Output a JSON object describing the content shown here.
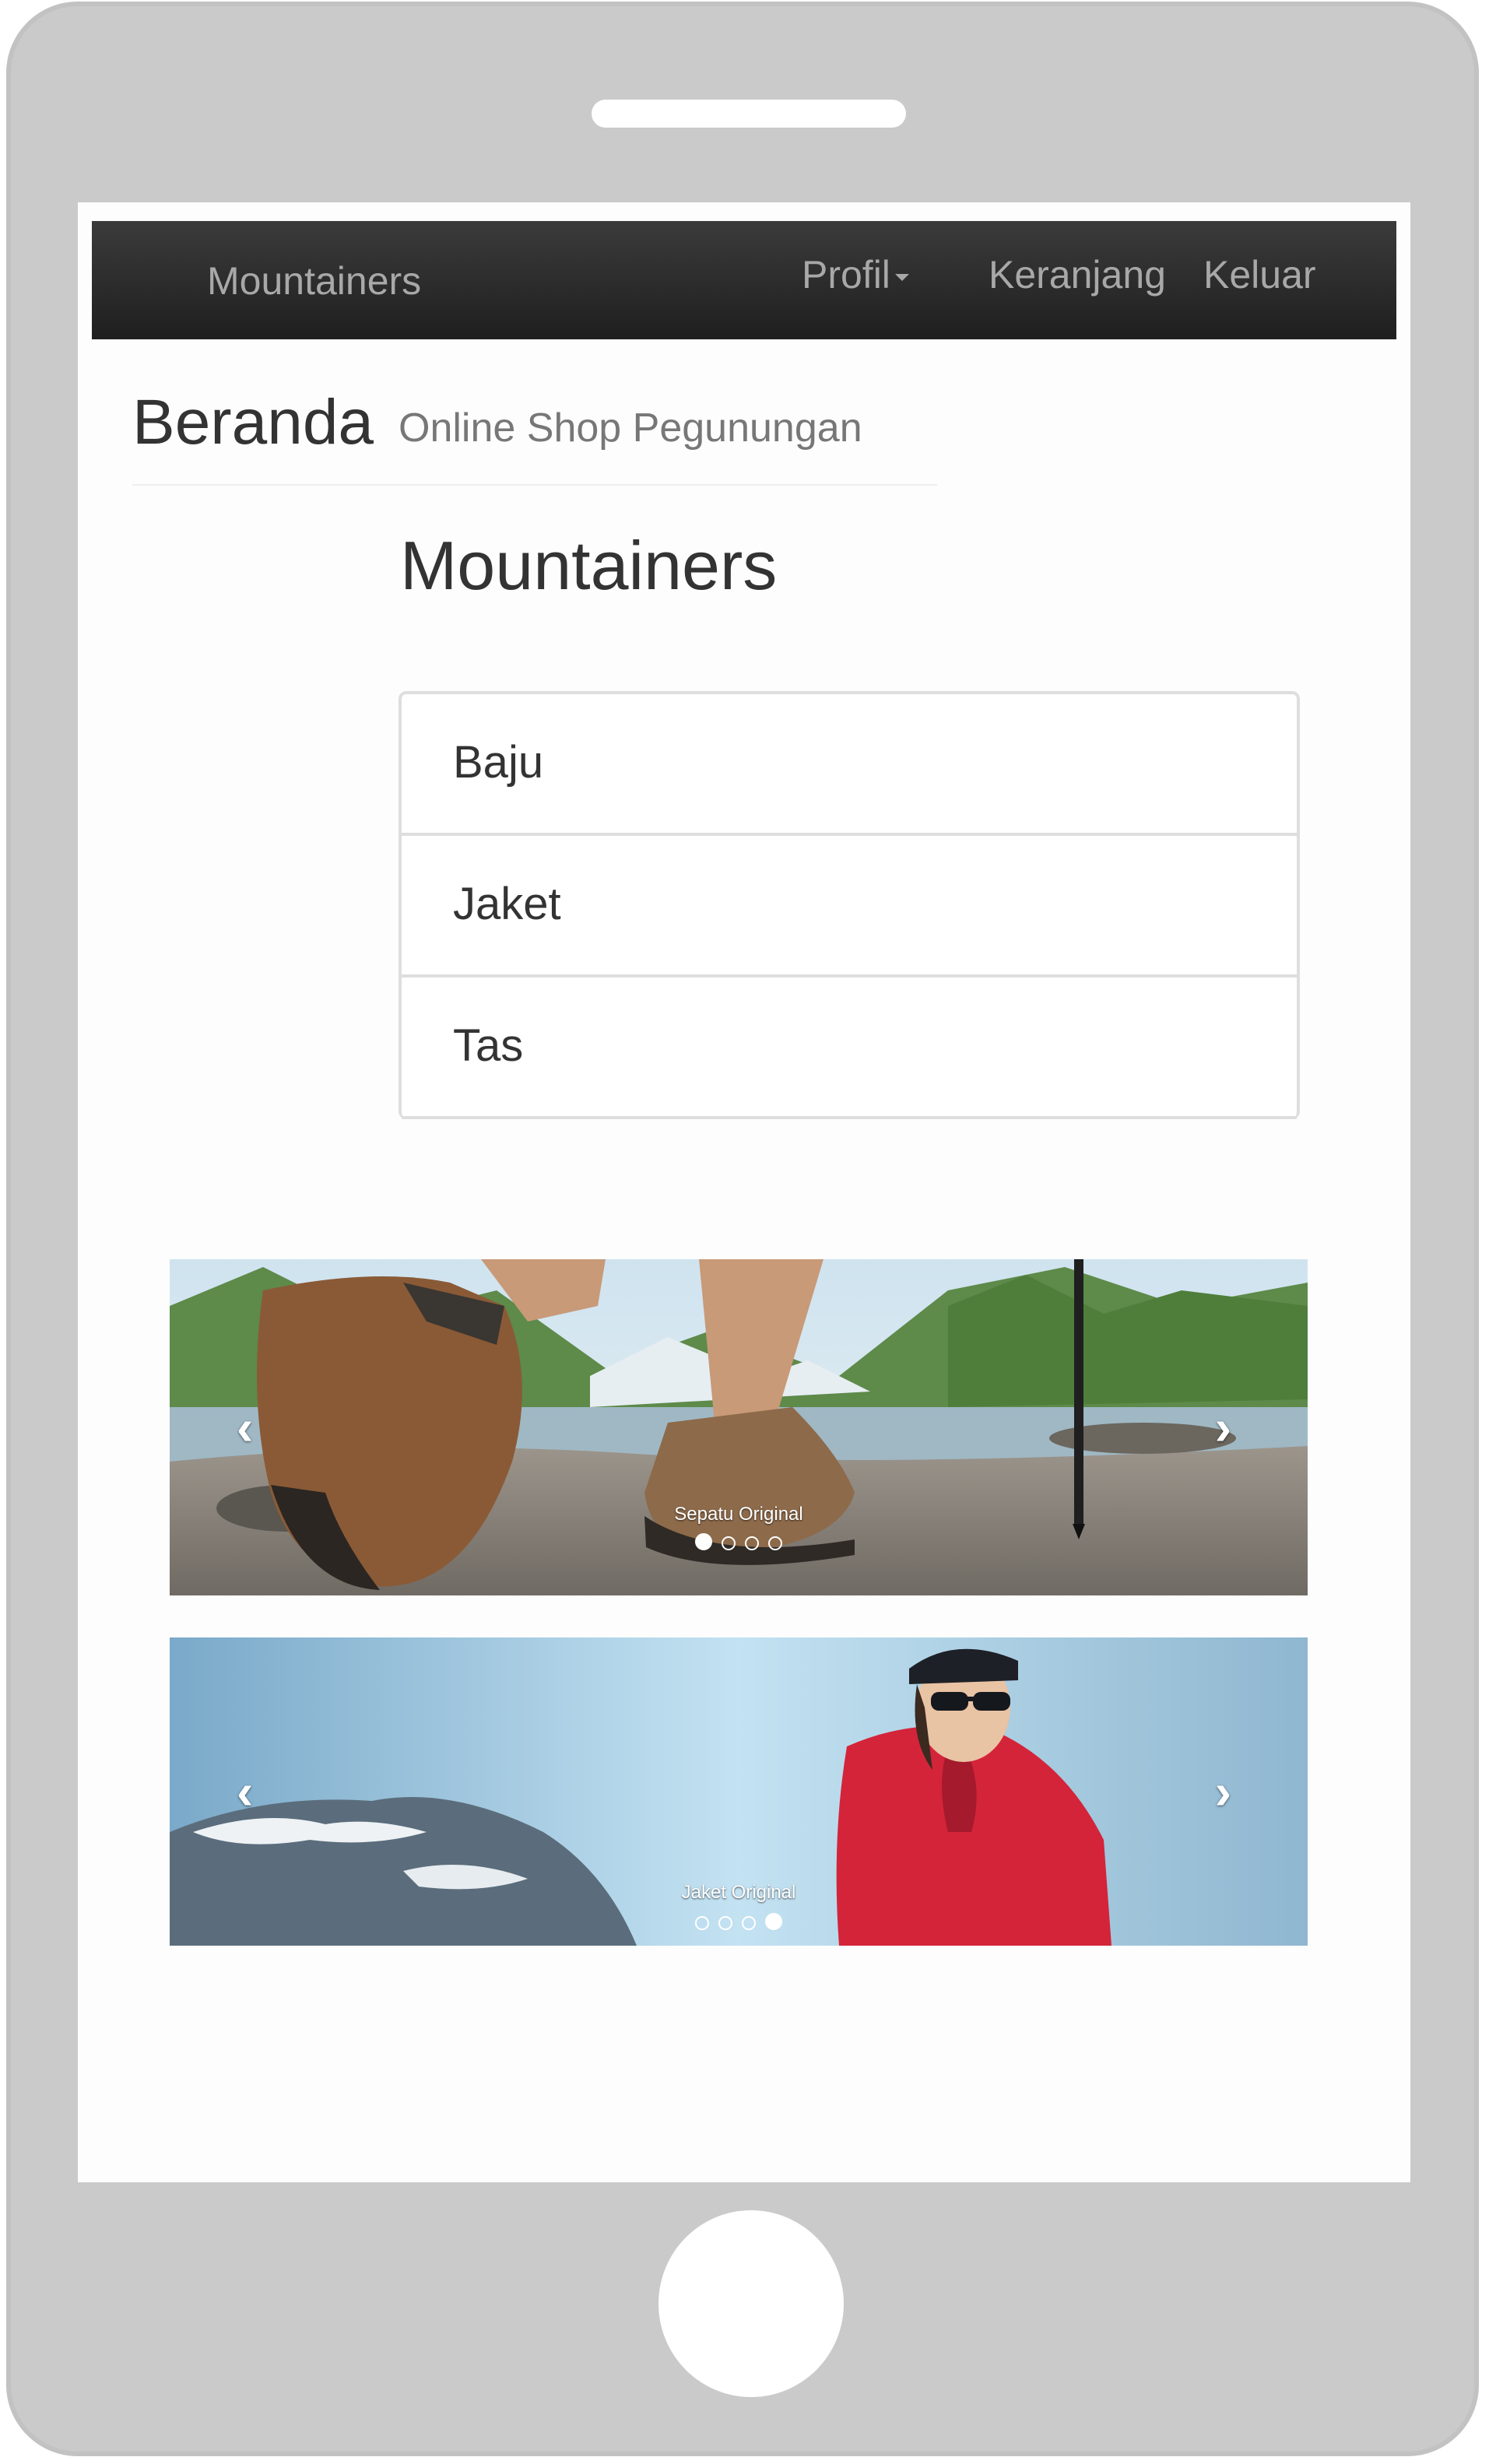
{
  "navbar": {
    "brand": "Mountainers",
    "items": [
      {
        "label": "Profil",
        "has_dropdown": true
      },
      {
        "label": "Keranjang"
      },
      {
        "label": "Keluar"
      }
    ]
  },
  "page_header": {
    "title": "Beranda",
    "subtitle": "Online Shop Pegunungan"
  },
  "sidebar": {
    "heading": "Mountainers",
    "items": [
      {
        "label": "Baju"
      },
      {
        "label": "Jaket"
      },
      {
        "label": "Tas"
      }
    ]
  },
  "carousels": [
    {
      "caption": "Sepatu Original",
      "slide_count": 4,
      "active_index": 0,
      "prev_icon": "chevron-left-icon",
      "next_icon": "chevron-right-icon"
    },
    {
      "caption": "Jaket Original",
      "slide_count": 4,
      "active_index": 3,
      "prev_icon": "chevron-left-icon",
      "next_icon": "chevron-right-icon"
    }
  ],
  "colors": {
    "phone_frame": "#cacaca",
    "navbar_bg": "#2b2b2b",
    "nav_text": "#a8a8a8",
    "list_border": "#dedede",
    "jacket_red": "#d4243a",
    "sky_blue": "#a9d4ea"
  }
}
